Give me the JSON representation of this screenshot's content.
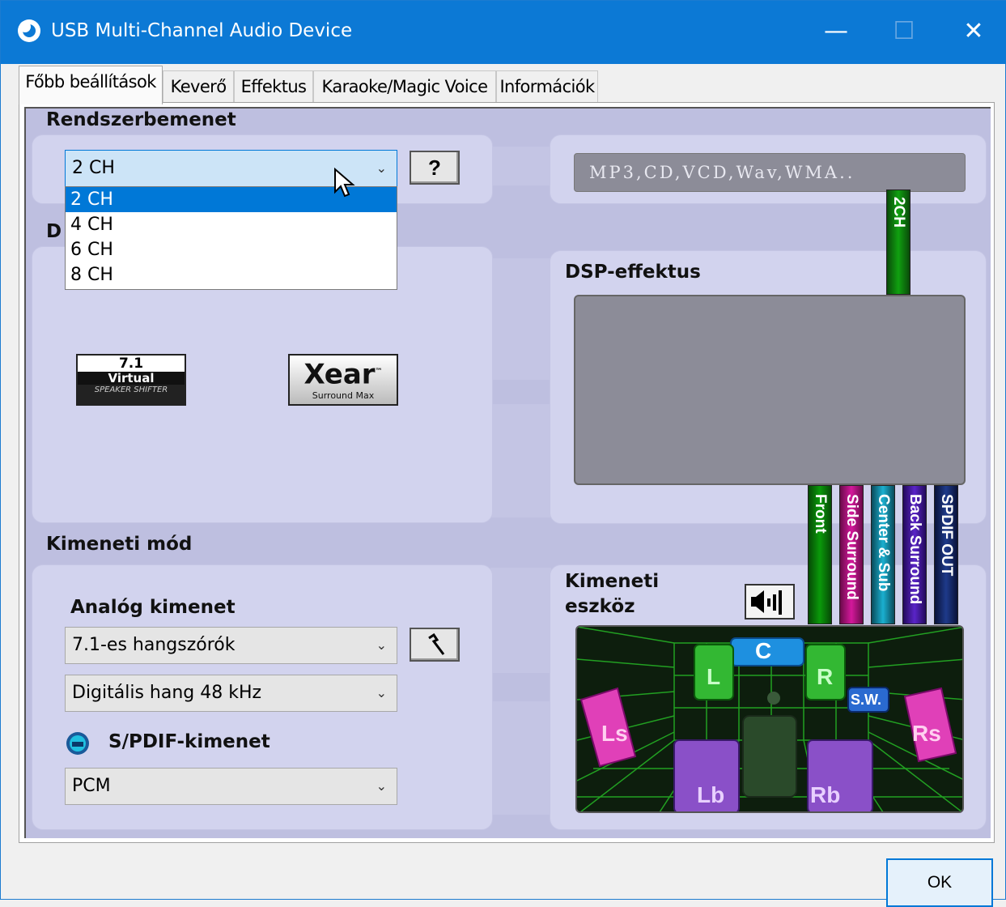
{
  "window": {
    "title": "USB Multi-Channel Audio Device",
    "min_icon": "minimize-icon",
    "max_icon": "maximize-icon",
    "close_icon": "close-icon"
  },
  "tabs": [
    {
      "label": "Főbb beállítások",
      "active": true
    },
    {
      "label": "Keverő",
      "active": false
    },
    {
      "label": "Effektus",
      "active": false
    },
    {
      "label": "Karaoke/Magic Voice",
      "active": false
    },
    {
      "label": "Információk",
      "active": false
    }
  ],
  "input": {
    "header": "Rendszerbemenet",
    "selected": "2 CH",
    "options": [
      "2 CH",
      "4 CH",
      "6 CH",
      "8 CH"
    ],
    "help_label": "?",
    "source_text": "MP3,CD,VCD,Wav,WMA..",
    "channel_label": "2CH"
  },
  "dsp": {
    "header_partial": "D",
    "logo1": {
      "top": "7.1",
      "mid": "Virtual",
      "bottom": "SPEAKER SHIFTER"
    },
    "logo2": {
      "main": "Xear",
      "tm": "™",
      "sub": "Surround Max"
    },
    "effect_header": "DSP-effektus"
  },
  "output": {
    "header": "Kimeneti mód",
    "analog_header": "Analóg kimenet",
    "speakers": "7.1-es hangszórók",
    "digital": "Digitális hang 48 kHz",
    "spdif_header": "S/PDIF-kimenet",
    "spdif_value": "PCM",
    "device_header_line1": "Kimeneti",
    "device_header_line2": "eszköz"
  },
  "strips": [
    {
      "label": "Front",
      "color": "#0a7a0a"
    },
    {
      "label": "Side Surround",
      "color": "#c2118b"
    },
    {
      "label": "Center & Sub",
      "color": "#1296b4"
    },
    {
      "label": "Back Surround",
      "color": "#4a1aa8"
    },
    {
      "label": "SPDIF OUT",
      "color": "#1a2a6a"
    }
  ],
  "speakers": {
    "C": "C",
    "L": "L",
    "R": "R",
    "SW": "S.W.",
    "Ls": "Ls",
    "Rs": "Rs",
    "Lb": "Lb",
    "Rb": "Rb"
  },
  "ok_label": "OK"
}
